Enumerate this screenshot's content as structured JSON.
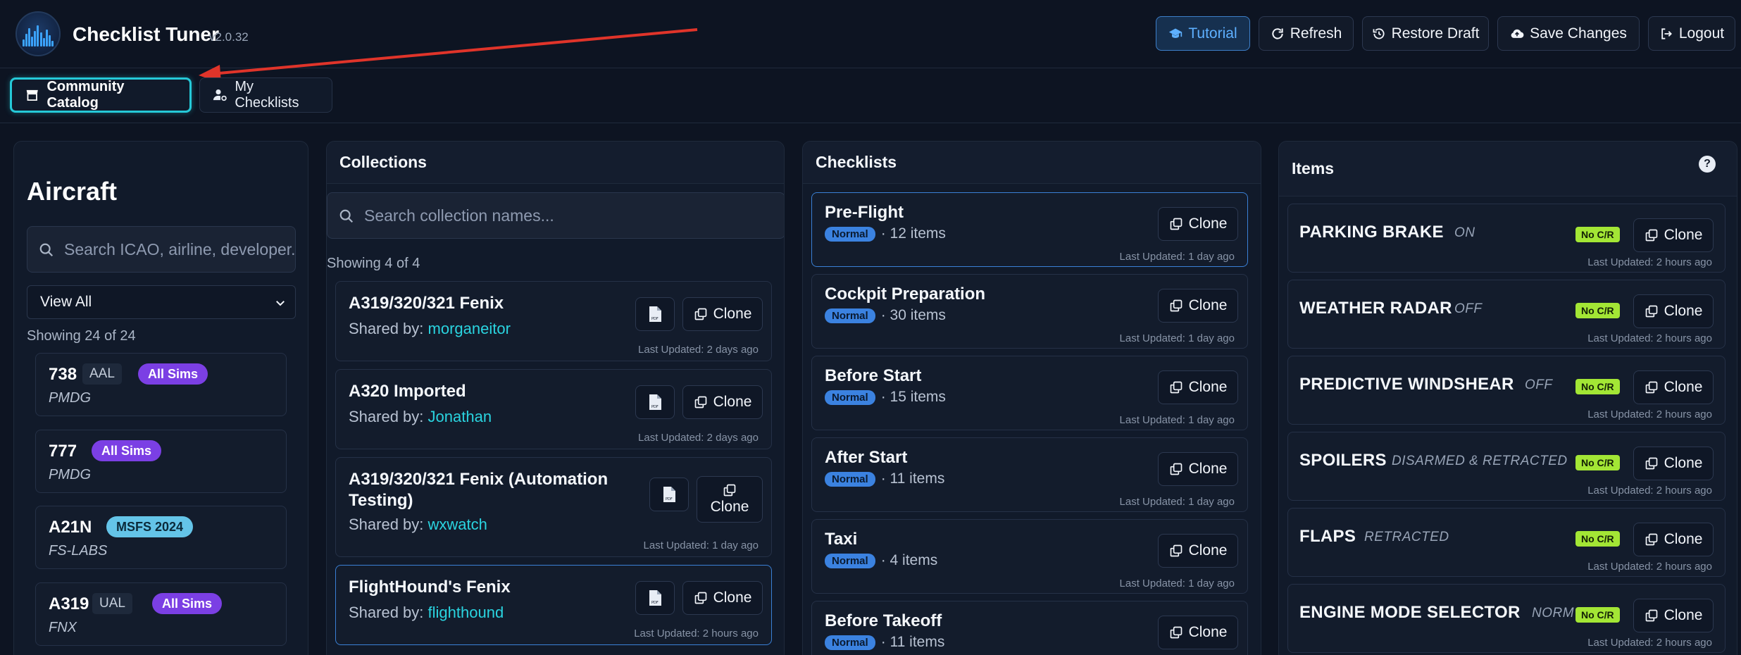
{
  "header": {
    "app_title": "Checklist Tuner",
    "version": "v2.0.32",
    "buttons": {
      "tutorial": "Tutorial",
      "refresh": "Refresh",
      "restore_draft": "Restore Draft",
      "save_changes": "Save Changes",
      "logout": "Logout"
    },
    "colors": {
      "accent": "#5eb0ff",
      "active_tab_border": "#25c9d8",
      "annotation_arrow": "#e0342a"
    }
  },
  "tabs": {
    "community_catalog": "Community Catalog",
    "my_checklists": "My Checklists"
  },
  "aircraft": {
    "title": "Aircraft",
    "search_placeholder": "Search ICAO, airline, developer...",
    "filter_selected": "View All",
    "showing": "Showing 24 of 24",
    "items": [
      {
        "code": "738",
        "airline": "AAL",
        "sim": "All Sims",
        "developer": "PMDG"
      },
      {
        "code": "777",
        "airline": "",
        "sim": "All Sims",
        "developer": "PMDG"
      },
      {
        "code": "A21N",
        "airline": "",
        "sim": "MSFS 2024",
        "developer": "FS-LABS"
      },
      {
        "code": "A319",
        "airline": "UAL",
        "sim": "All Sims",
        "developer": "FNX"
      }
    ]
  },
  "collections": {
    "title": "Collections",
    "search_placeholder": "Search collection names...",
    "showing": "Showing 4 of 4",
    "shared_prefix": "Shared by:",
    "clone_label": "Clone",
    "items": [
      {
        "name": "A319/320/321 Fenix",
        "shared_by": "morganeitor",
        "updated": "Last Updated: 2 days ago"
      },
      {
        "name": "A320 Imported",
        "shared_by": "Jonathan",
        "updated": "Last Updated: 2 days ago"
      },
      {
        "name": "A319/320/321 Fenix (Automation Testing)",
        "shared_by": "wxwatch",
        "updated": "Last Updated: 1 day ago"
      },
      {
        "name": "FlightHound's Fenix",
        "shared_by": "flighthound",
        "updated": "Last Updated: 2 hours ago"
      }
    ]
  },
  "checklists": {
    "title": "Checklists",
    "clone_label": "Clone",
    "items": [
      {
        "name": "Pre-Flight",
        "type": "Normal",
        "count": "· 12 items",
        "updated": "Last Updated: 1 day ago"
      },
      {
        "name": "Cockpit Preparation",
        "type": "Normal",
        "count": "· 30 items",
        "updated": "Last Updated: 1 day ago"
      },
      {
        "name": "Before Start",
        "type": "Normal",
        "count": "· 15 items",
        "updated": "Last Updated: 1 day ago"
      },
      {
        "name": "After Start",
        "type": "Normal",
        "count": "· 11 items",
        "updated": "Last Updated: 1 day ago"
      },
      {
        "name": "Taxi",
        "type": "Normal",
        "count": "· 4 items",
        "updated": "Last Updated: 1 day ago"
      },
      {
        "name": "Before Takeoff",
        "type": "Normal",
        "count": "· 11 items",
        "updated": ""
      }
    ]
  },
  "items_panel": {
    "title": "Items",
    "help": "?",
    "clone_label": "Clone",
    "badge": "No C/R",
    "items": [
      {
        "name": "PARKING BRAKE",
        "value": "ON",
        "updated": "Last Updated: 2 hours ago"
      },
      {
        "name": "WEATHER RADAR",
        "value": "OFF",
        "updated": "Last Updated: 2 hours ago"
      },
      {
        "name": "PREDICTIVE WINDSHEAR",
        "value": "OFF",
        "updated": "Last Updated: 2 hours ago"
      },
      {
        "name": "SPOILERS",
        "value": "DISARMED & RETRACTED",
        "updated": "Last Updated: 2 hours ago"
      },
      {
        "name": "FLAPS",
        "value": "RETRACTED",
        "updated": "Last Updated: 2 hours ago"
      },
      {
        "name": "ENGINE MODE SELECTOR",
        "value": "NORM",
        "updated": "Last Updated: 2 hours ago"
      }
    ]
  }
}
